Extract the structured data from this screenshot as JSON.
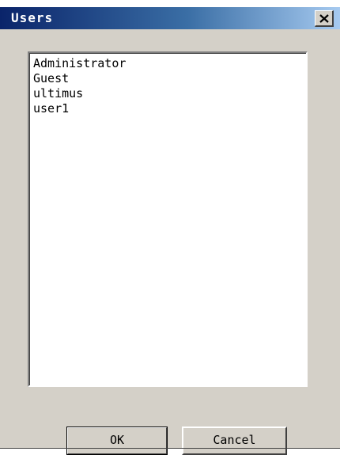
{
  "window": {
    "title": "Users",
    "close_icon": "close-icon"
  },
  "users_list": {
    "items": [
      {
        "label": "Administrator"
      },
      {
        "label": "Guest"
      },
      {
        "label": "ultimus"
      },
      {
        "label": "user1"
      }
    ]
  },
  "buttons": {
    "ok_label": "OK",
    "cancel_label": "Cancel"
  },
  "colors": {
    "titlebar_start": "#0a246a",
    "titlebar_end": "#a6caf0",
    "dialog_face": "#d4d0c8",
    "list_background": "#ffffff"
  }
}
